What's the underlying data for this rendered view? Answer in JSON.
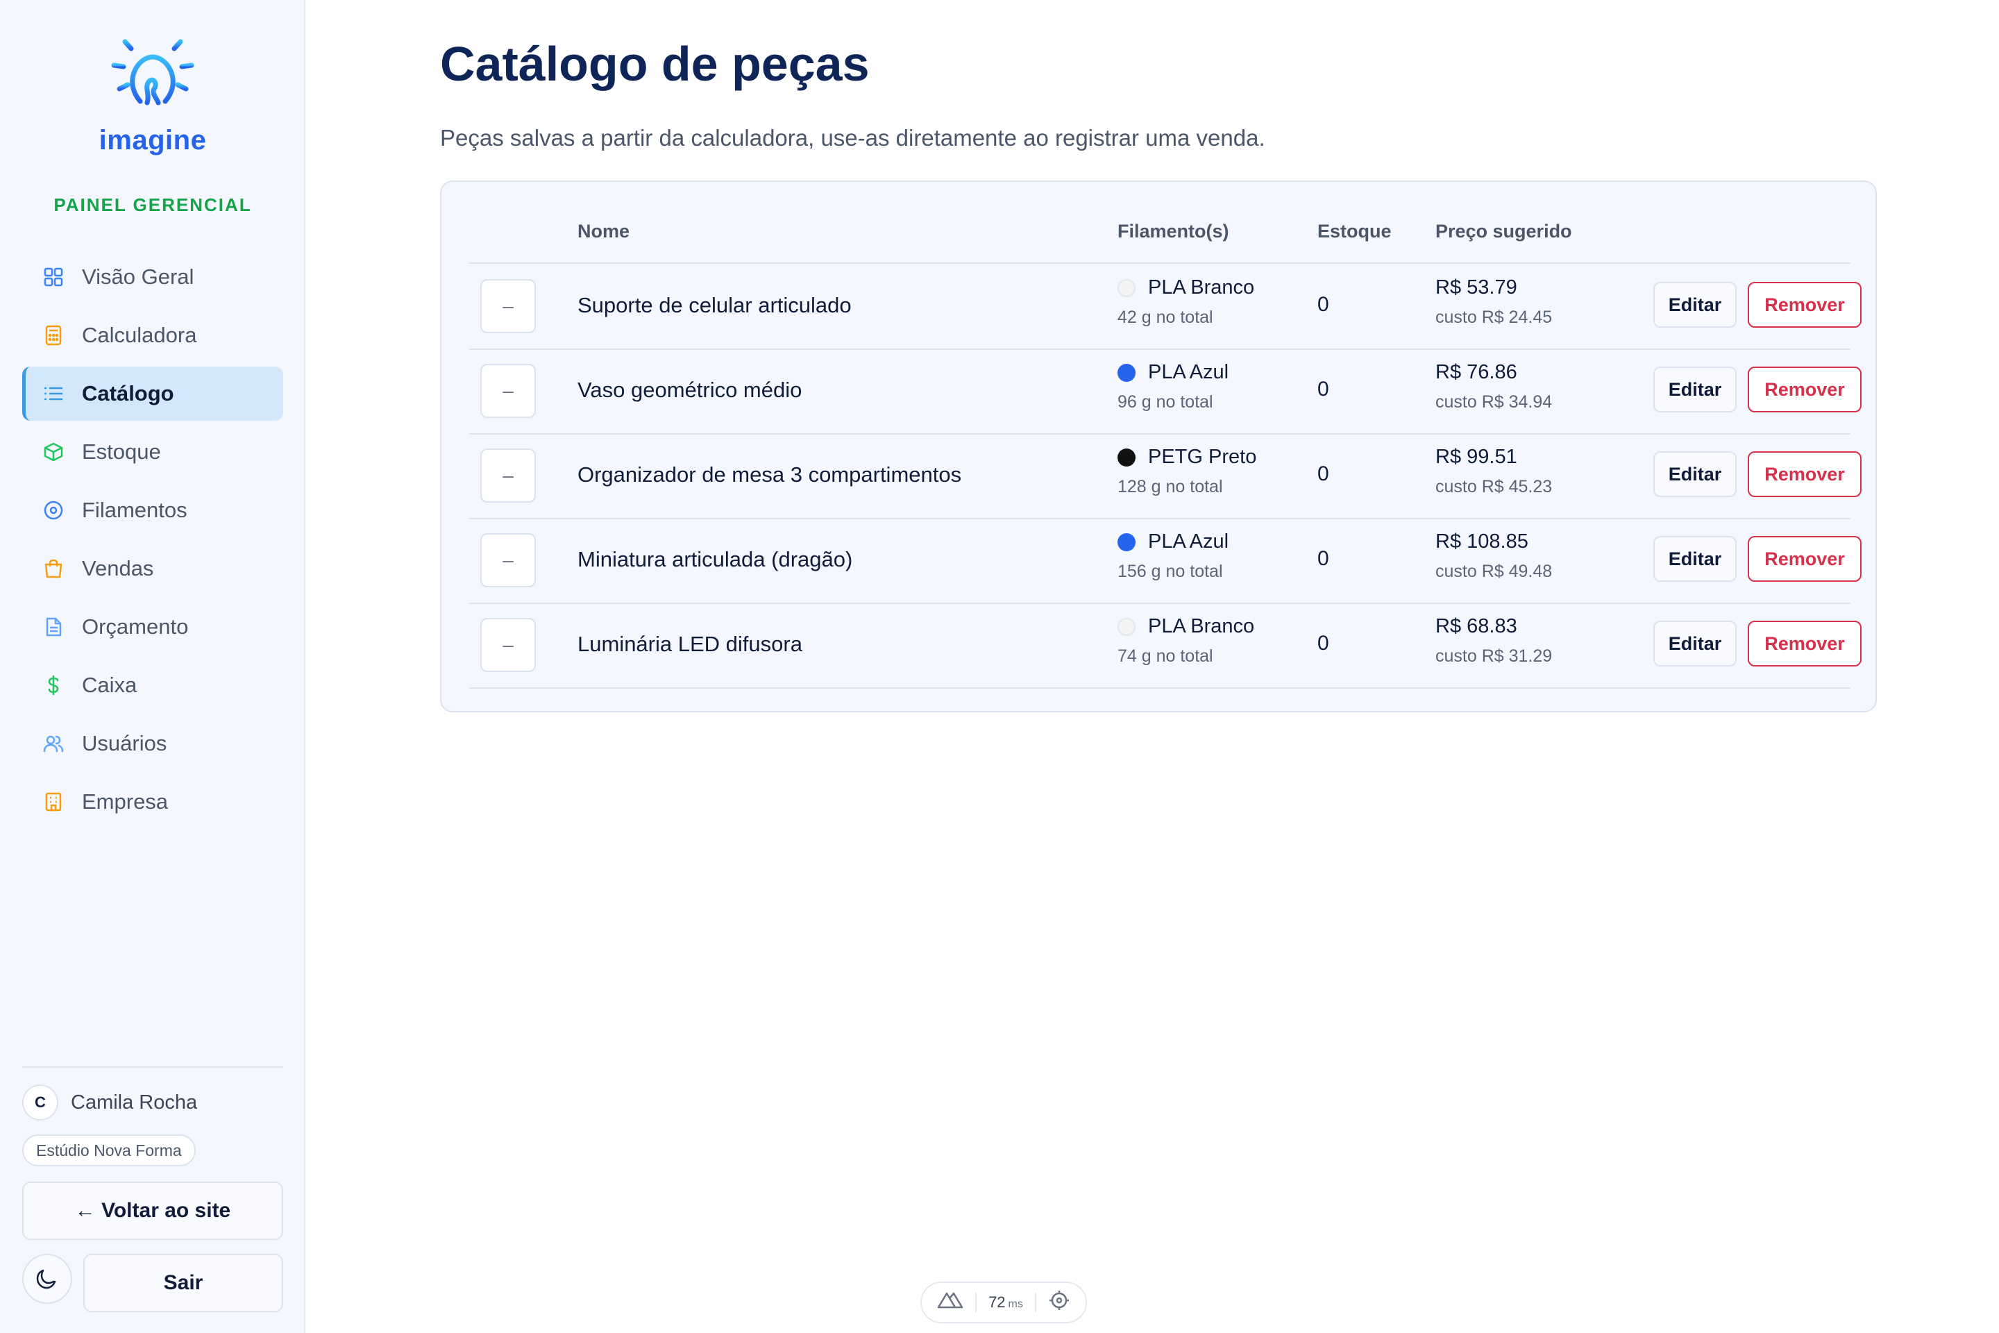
{
  "brand": {
    "name": "imagine",
    "panel_label": "PAINEL GERENCIAL"
  },
  "nav": [
    {
      "label": "Visão Geral",
      "icon": "grid-icon",
      "active": false
    },
    {
      "label": "Calculadora",
      "icon": "calculator-icon",
      "active": false
    },
    {
      "label": "Catálogo",
      "icon": "list-icon",
      "active": true
    },
    {
      "label": "Estoque",
      "icon": "box-icon",
      "active": false
    },
    {
      "label": "Filamentos",
      "icon": "spool-icon",
      "active": false
    },
    {
      "label": "Vendas",
      "icon": "cart-icon",
      "active": false
    },
    {
      "label": "Orçamento",
      "icon": "document-icon",
      "active": false
    },
    {
      "label": "Caixa",
      "icon": "dollar-icon",
      "active": false
    },
    {
      "label": "Usuários",
      "icon": "users-icon",
      "active": false
    },
    {
      "label": "Empresa",
      "icon": "building-icon",
      "active": false
    }
  ],
  "user": {
    "initial": "C",
    "name": "Camila Rocha",
    "company": "Estúdio Nova Forma"
  },
  "actions": {
    "back": "← Voltar ao site",
    "logout": "Sair"
  },
  "page": {
    "title": "Catálogo de peças",
    "subtitle": "Peças salvas a partir da calculadora, use-as diretamente ao registrar uma venda."
  },
  "table": {
    "headers": {
      "name": "Nome",
      "filament": "Filamento(s)",
      "stock": "Estoque",
      "price": "Preço sugerido"
    },
    "edit_label": "Editar",
    "remove_label": "Remover",
    "rows": [
      {
        "thumb": "–",
        "name": "Suporte de celular articulado",
        "filament": "PLA Branco",
        "filament_color": "#f3f4f6",
        "grams": "42 g no total",
        "stock": "0",
        "price": "R$ 53.79",
        "cost": "custo R$ 24.45"
      },
      {
        "thumb": "–",
        "name": "Vaso geométrico médio",
        "filament": "PLA Azul",
        "filament_color": "#2563eb",
        "grams": "96 g no total",
        "stock": "0",
        "price": "R$ 76.86",
        "cost": "custo R$ 34.94"
      },
      {
        "thumb": "–",
        "name": "Organizador de mesa 3 compartimentos",
        "filament": "PETG Preto",
        "filament_color": "#111111",
        "grams": "128 g no total",
        "stock": "0",
        "price": "R$ 99.51",
        "cost": "custo R$ 45.23"
      },
      {
        "thumb": "–",
        "name": "Miniatura articulada (dragão)",
        "filament": "PLA Azul",
        "filament_color": "#2563eb",
        "grams": "156 g no total",
        "stock": "0",
        "price": "R$ 108.85",
        "cost": "custo R$ 49.48"
      },
      {
        "thumb": "–",
        "name": "Luminária LED difusora",
        "filament": "PLA Branco",
        "filament_color": "#f3f4f6",
        "grams": "74 g no total",
        "stock": "0",
        "price": "R$ 68.83",
        "cost": "custo R$ 31.29"
      }
    ]
  },
  "devbar": {
    "value": "72",
    "unit": "ms"
  },
  "colors": {
    "accent": "#2563eb",
    "panel": "#16a34a",
    "danger": "#d6304b",
    "active_bg": "#d3e8fb"
  }
}
